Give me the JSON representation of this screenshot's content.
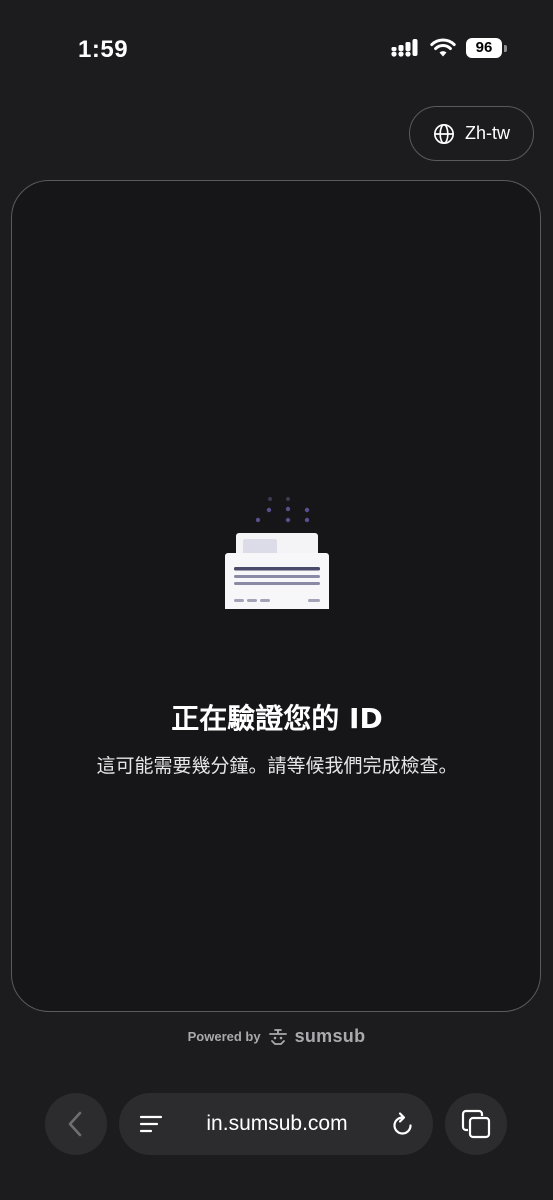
{
  "status_bar": {
    "time": "1:59",
    "battery": "96"
  },
  "language_button": {
    "label": "Zh-tw"
  },
  "verification": {
    "title": "正在驗證您的 ID",
    "subtitle": "這可能需要幾分鐘。請等候我們完成檢查。"
  },
  "footer": {
    "powered_label": "Powered by",
    "brand": "sumsub"
  },
  "browser": {
    "url": "in.sumsub.com"
  },
  "colors": {
    "background": "#1c1c1e",
    "card": "#161618",
    "accent_dots": "#5b4e8c",
    "doc_lines": "#5a5a78"
  }
}
